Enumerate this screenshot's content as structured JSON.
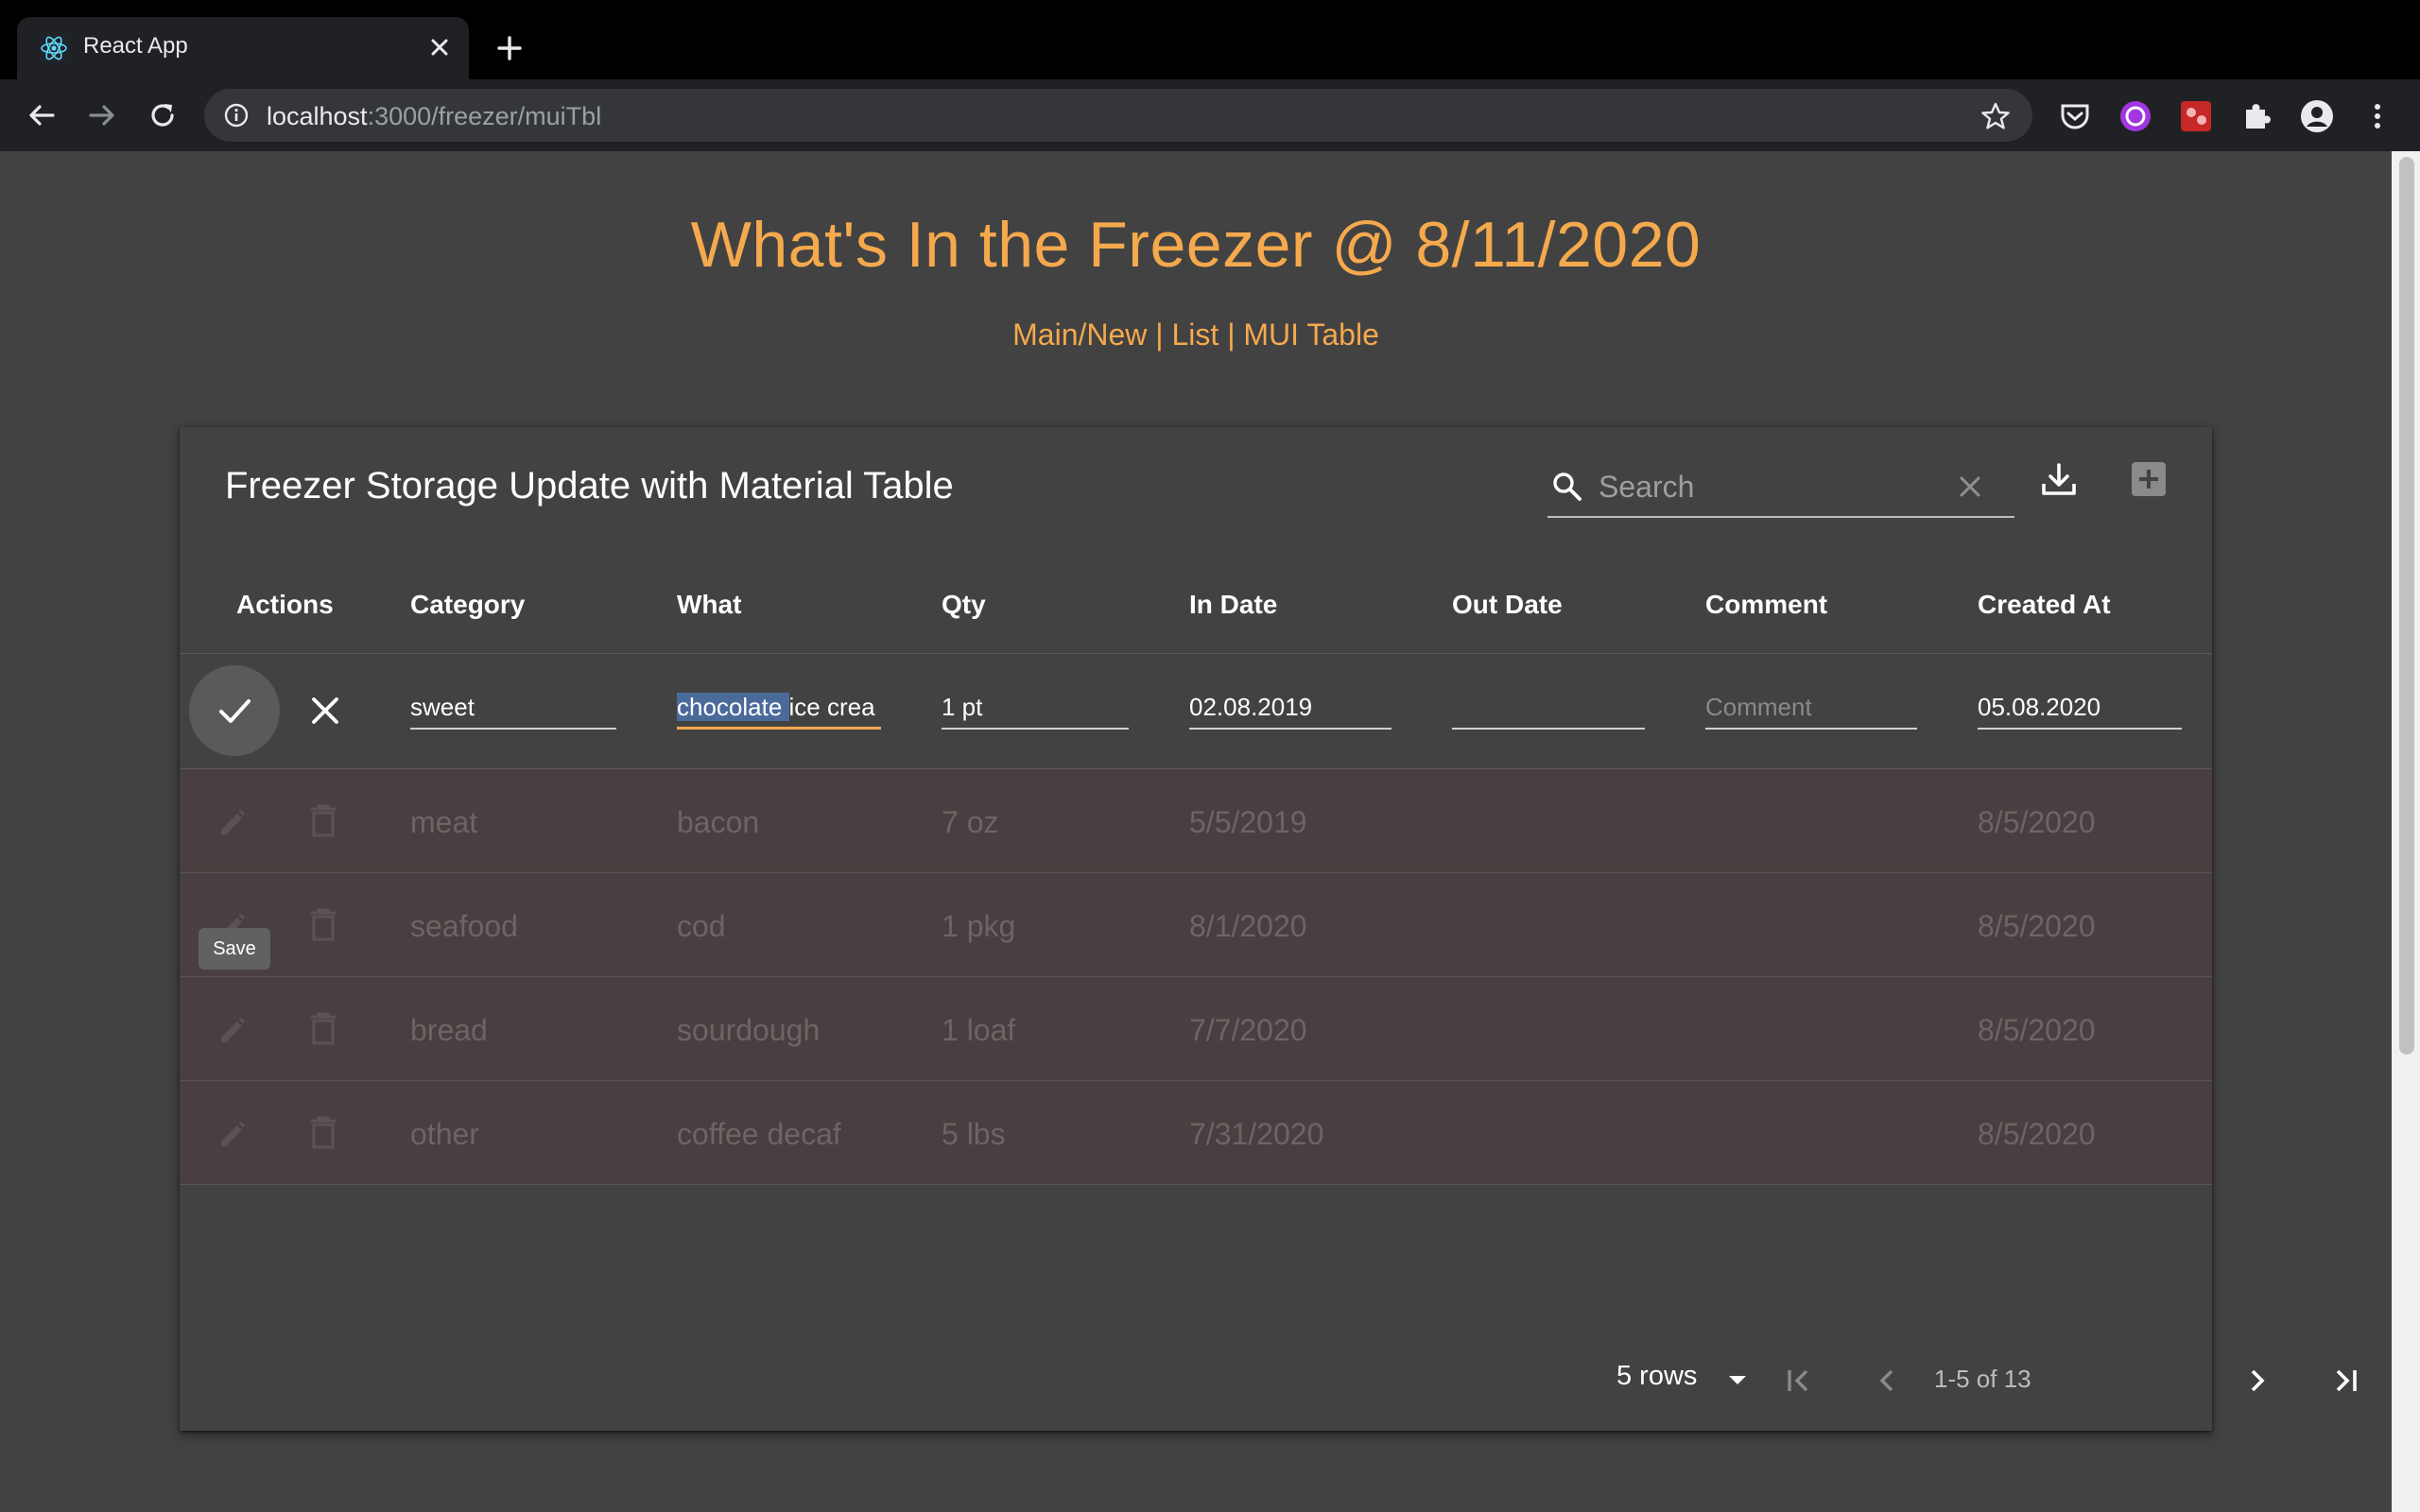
{
  "browser": {
    "tab_title": "React App",
    "url_host": "localhost",
    "url_path": ":3000/freezer/muiTbl"
  },
  "page": {
    "title": "What's In the Freezer @ 8/11/2020",
    "nav": {
      "main_new": "Main/New",
      "sep1": " | ",
      "list": "List",
      "sep2": " | ",
      "mui_table": "MUI Table"
    }
  },
  "table": {
    "title": "Freezer Storage Update with Material Table",
    "search_placeholder": "Search",
    "columns": [
      "Actions",
      "Category",
      "What",
      "Qty",
      "In Date",
      "Out Date",
      "Comment",
      "Created At"
    ],
    "edit_row": {
      "category": "sweet",
      "what_selected": "chocolate ",
      "what_rest": "ice crea",
      "qty": "1 pt",
      "in_date": "02.08.2019",
      "out_date": "",
      "comment_placeholder": "Comment",
      "created_at": "05.08.2020"
    },
    "save_tooltip": "Save",
    "rows": [
      {
        "category": "meat",
        "what": "bacon",
        "qty": "7 oz",
        "in_date": "5/5/2019",
        "out_date": "",
        "comment": "",
        "created_at": "8/5/2020"
      },
      {
        "category": "seafood",
        "what": "cod",
        "qty": "1 pkg",
        "in_date": "8/1/2020",
        "out_date": "",
        "comment": "",
        "created_at": "8/5/2020"
      },
      {
        "category": "bread",
        "what": "sourdough",
        "qty": "1 loaf",
        "in_date": "7/7/2020",
        "out_date": "",
        "comment": "",
        "created_at": "8/5/2020"
      },
      {
        "category": "other",
        "what": "coffee decaf",
        "qty": "5 lbs",
        "in_date": "7/31/2020",
        "out_date": "",
        "comment": "",
        "created_at": "8/5/2020"
      }
    ],
    "pagination": {
      "rows_per_page": "5 rows",
      "range": "1-5 of 13"
    }
  },
  "colors": {
    "accent": "#f5a94d",
    "page_bg": "#424242",
    "row_bg": "#4a3f40"
  }
}
